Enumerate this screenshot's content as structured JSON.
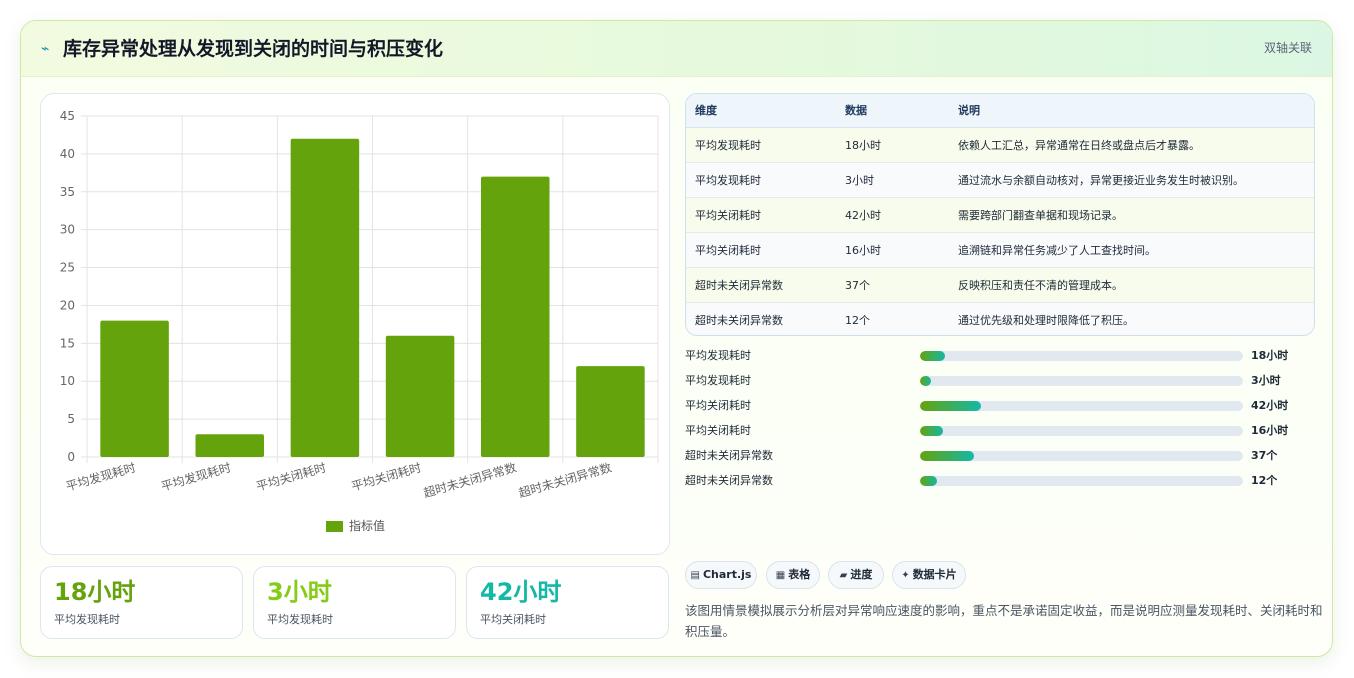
{
  "header": {
    "icon": "zigzag-arrow-icon",
    "title": "库存异常处理从发现到关闭的时间与积压变化",
    "tag": "双轴关联"
  },
  "chart_data": {
    "type": "bar",
    "categories": [
      "平均发现耗时",
      "平均发现耗时",
      "平均关闭耗时",
      "平均关闭耗时",
      "超时未关闭异常数",
      "超时未关闭异常数"
    ],
    "series": [
      {
        "name": "指标值",
        "values": [
          18,
          3,
          42,
          16,
          37,
          12
        ],
        "color": "#65a30d"
      }
    ],
    "yticks": [
      "0",
      "5",
      "10",
      "15",
      "20",
      "25",
      "30",
      "35",
      "40",
      "45"
    ],
    "ylim": [
      0,
      45
    ],
    "grid": true,
    "legend": "bottom"
  },
  "stats": [
    {
      "value": "18小时",
      "label": "平均发现耗时",
      "color": "#65a30d"
    },
    {
      "value": "3小时",
      "label": "平均发现耗时",
      "color": "#84cc16"
    },
    {
      "value": "42小时",
      "label": "平均关闭耗时",
      "color": "#14b8a6"
    }
  ],
  "table": {
    "headers": [
      "维度",
      "数据",
      "说明"
    ],
    "rows": [
      [
        "平均发现耗时",
        "18小时",
        "依赖人工汇总，异常通常在日终或盘点后才暴露。"
      ],
      [
        "平均发现耗时",
        "3小时",
        "通过流水与余额自动核对，异常更接近业务发生时被识别。"
      ],
      [
        "平均关闭耗时",
        "42小时",
        "需要跨部门翻查单据和现场记录。"
      ],
      [
        "平均关闭耗时",
        "16小时",
        "追溯链和异常任务减少了人工查找时间。"
      ],
      [
        "超时未关闭异常数",
        "37个",
        "反映积压和责任不清的管理成本。"
      ],
      [
        "超时未关闭异常数",
        "12个",
        "通过优先级和处理时限降低了积压。"
      ]
    ]
  },
  "progress": [
    {
      "label": "平均发现耗时",
      "value": "18小时",
      "fraction": 0.077
    },
    {
      "label": "平均发现耗时",
      "value": "3小时",
      "fraction": 0.035
    },
    {
      "label": "平均关闭耗时",
      "value": "42小时",
      "fraction": 0.189
    },
    {
      "label": "平均关闭耗时",
      "value": "16小时",
      "fraction": 0.071
    },
    {
      "label": "超时未关闭异常数",
      "value": "37个",
      "fraction": 0.167
    },
    {
      "label": "超时未关闭异常数",
      "value": "12个",
      "fraction": 0.053
    }
  ],
  "chips": [
    {
      "icon": "chart-icon",
      "glyph": "▤",
      "label": "Chart.js"
    },
    {
      "icon": "table-icon",
      "glyph": "▦",
      "label": "表格"
    },
    {
      "icon": "progress-icon",
      "glyph": "▰",
      "label": "进度"
    },
    {
      "icon": "sparkle-icon",
      "glyph": "✦",
      "label": "数据卡片"
    }
  ],
  "description": "该图用情景模拟展示分析层对异常响应速度的影响，重点不是承诺固定收益，而是说明应测量发现耗时、关闭耗时和积压量。"
}
